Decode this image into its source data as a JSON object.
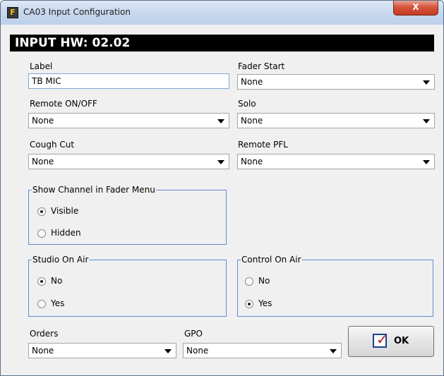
{
  "window": {
    "title": "CA03 Input Configuration",
    "icon_glyph": "F",
    "close_glyph": "X"
  },
  "header": {
    "text": "INPUT HW: 02.02"
  },
  "label": {
    "caption": "Label",
    "value": "TB MIC"
  },
  "fader_start": {
    "caption": "Fader Start",
    "value": "None"
  },
  "remote_onoff": {
    "caption": "Remote ON/OFF",
    "value": "None"
  },
  "solo": {
    "caption": "Solo",
    "value": "None"
  },
  "cough_cut": {
    "caption": "Cough Cut",
    "value": "None"
  },
  "remote_pfl": {
    "caption": "Remote PFL",
    "value": "None"
  },
  "show_channel": {
    "title": "Show Channel in Fader Menu",
    "options": [
      {
        "label": "Visible",
        "checked": true
      },
      {
        "label": "Hidden",
        "checked": false
      }
    ]
  },
  "studio_on_air": {
    "title": "Studio On Air",
    "options": [
      {
        "label": "No",
        "checked": true
      },
      {
        "label": "Yes",
        "checked": false
      }
    ]
  },
  "control_on_air": {
    "title": "Control On Air",
    "options": [
      {
        "label": "No",
        "checked": false
      },
      {
        "label": "Yes",
        "checked": true
      }
    ]
  },
  "orders": {
    "caption": "Orders",
    "value": "None"
  },
  "gpo": {
    "caption": "GPO",
    "value": "None"
  },
  "ok_button": {
    "label": "OK",
    "check_glyph": "✓"
  },
  "colors": {
    "titlebar": "#c7d8ee",
    "header_bg": "#000000",
    "close": "#c13a1f",
    "group_border": "#5b8fd0",
    "check": "#c01a1a"
  },
  "icons": [
    "app-icon",
    "close-icon",
    "dropdown-arrow-icon",
    "ok-check-icon"
  ]
}
